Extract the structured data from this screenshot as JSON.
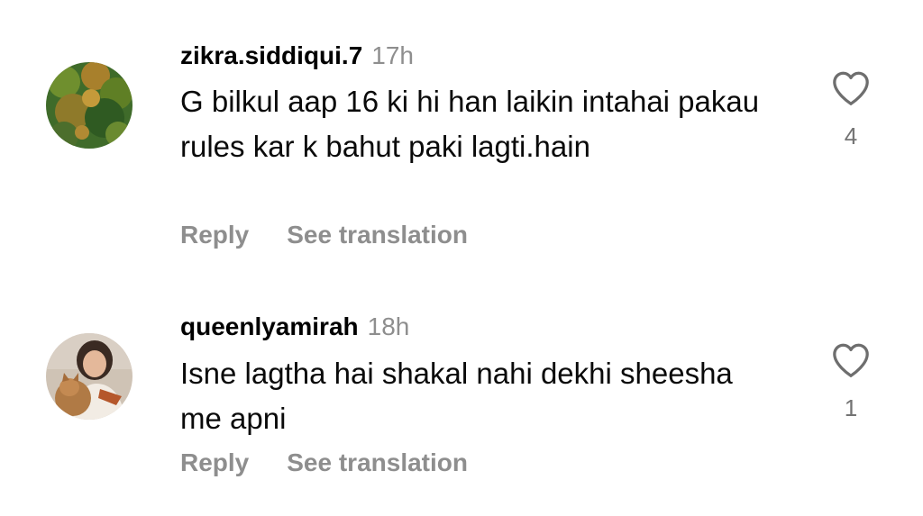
{
  "comments": [
    {
      "username": "zikra.siddiqui.7",
      "time": "17h",
      "text": "G bilkul aap 16 ki hi han laikin intahai pakau rules kar k bahut paki lagti.hain",
      "reply_label": "Reply",
      "translate_label": "See translation",
      "likes": "4",
      "avatar_icon": "nature-photo-avatar"
    },
    {
      "username": "queenlyamirah",
      "time": "18h",
      "text": "Isne lagtha hai shakal nahi dekhi sheesha me apni",
      "reply_label": "Reply",
      "translate_label": "See translation",
      "likes": "1",
      "avatar_icon": "person-with-cat-avatar"
    }
  ],
  "colors": {
    "muted": "#8e8e8e",
    "text": "#000000",
    "background": "#ffffff"
  }
}
